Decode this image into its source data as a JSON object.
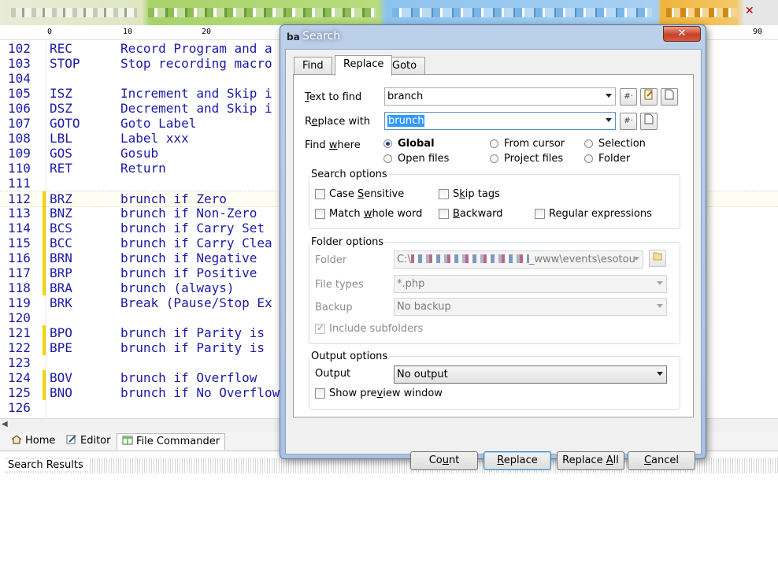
{
  "window": {
    "close_glyph": "✕"
  },
  "ruler": {
    "ticks": [
      "0",
      "10",
      "20",
      "90"
    ]
  },
  "editor": {
    "lines": [
      {
        "num": "102",
        "kw": "REC",
        "text": "Record Program and a"
      },
      {
        "num": "103",
        "kw": "STOP",
        "text": "Stop recording macro"
      },
      {
        "num": "104",
        "kw": "",
        "text": ""
      },
      {
        "num": "105",
        "kw": "ISZ",
        "text": "Increment and Skip i"
      },
      {
        "num": "106",
        "kw": "DSZ",
        "text": "Decrement and Skip i"
      },
      {
        "num": "107",
        "kw": "GOTO",
        "text": "Goto Label"
      },
      {
        "num": "108",
        "kw": "LBL",
        "text": "Label xxx"
      },
      {
        "num": "109",
        "kw": "GOS",
        "text": "Gosub"
      },
      {
        "num": "110",
        "kw": "RET",
        "text": "Return"
      },
      {
        "num": "111",
        "kw": "",
        "text": ""
      },
      {
        "num": "112",
        "kw": "BRZ",
        "text": "brunch if Zero"
      },
      {
        "num": "113",
        "kw": "BNZ",
        "text": "brunch if Non-Zero"
      },
      {
        "num": "114",
        "kw": "BCS",
        "text": "brunch if Carry Set"
      },
      {
        "num": "115",
        "kw": "BCC",
        "text": "brunch if Carry Clea"
      },
      {
        "num": "116",
        "kw": "BRN",
        "text": "brunch if Negative"
      },
      {
        "num": "117",
        "kw": "BRP",
        "text": "brunch if Positive"
      },
      {
        "num": "118",
        "kw": "BRA",
        "text": "brunch (always)"
      },
      {
        "num": "119",
        "kw": "BRK",
        "text": "Break (Pause/Stop Ex"
      },
      {
        "num": "120",
        "kw": "",
        "text": ""
      },
      {
        "num": "121",
        "kw": "BPO",
        "text": "brunch if Parity is"
      },
      {
        "num": "122",
        "kw": "BPE",
        "text": "brunch if Parity is"
      },
      {
        "num": "123",
        "kw": "",
        "text": ""
      },
      {
        "num": "124",
        "kw": "BOV",
        "text": "brunch if Overflow"
      },
      {
        "num": "125",
        "kw": "BNO",
        "text": "brunch if No Overflow"
      },
      {
        "num": "126",
        "kw": "",
        "text": ""
      }
    ],
    "marked_lines": [
      "112",
      "113",
      "114",
      "115",
      "116",
      "117",
      "118",
      "121",
      "122",
      "124",
      "125"
    ]
  },
  "bottom_tabs": [
    {
      "label": "Home",
      "icon": "home-icon"
    },
    {
      "label": "Editor",
      "icon": "editor-icon"
    },
    {
      "label": "File Commander",
      "icon": "file-commander-icon"
    }
  ],
  "search_results": {
    "title": "Search Results"
  },
  "dialog": {
    "title": "Search",
    "close_glyph": "✕",
    "tabs": [
      "Find",
      "Replace",
      "Goto"
    ],
    "active_tab": "Replace",
    "text_to_find": {
      "label": "Text to find",
      "value": "branch"
    },
    "replace_with": {
      "label": "Replace with",
      "value": "brunch"
    },
    "find_where": {
      "label": "Find where",
      "options": [
        "Global",
        "From cursor",
        "Selection",
        "Open files",
        "Project files",
        "Folder"
      ],
      "selected": "Global"
    },
    "search_options": {
      "title": "Search options",
      "case_sensitive": "Case Sensitive",
      "skip_tags": "Skip tags",
      "match_whole_word": "Match whole word",
      "backward": "Backward",
      "regular_expressions": "Regular expressions"
    },
    "folder_options": {
      "title": "Folder options",
      "folder_label": "Folder",
      "folder_value_prefix": "C:\\",
      "folder_value_suffix": "_www\\events\\esotou",
      "file_types_label": "File types",
      "file_types_value": "*.php",
      "backup_label": "Backup",
      "backup_value": "No backup",
      "include_subfolders": "Include subfolders"
    },
    "output_options": {
      "title": "Output options",
      "output_label": "Output",
      "output_value": "No output",
      "show_preview": "Show preview window"
    },
    "buttons": {
      "count": "Count",
      "replace": "Replace",
      "replace_all": "Replace All",
      "cancel": "Cancel"
    }
  },
  "colors": {
    "code_text": "#1a1aa6",
    "change_marker": "#f2d300",
    "selection": "#3399ff"
  }
}
